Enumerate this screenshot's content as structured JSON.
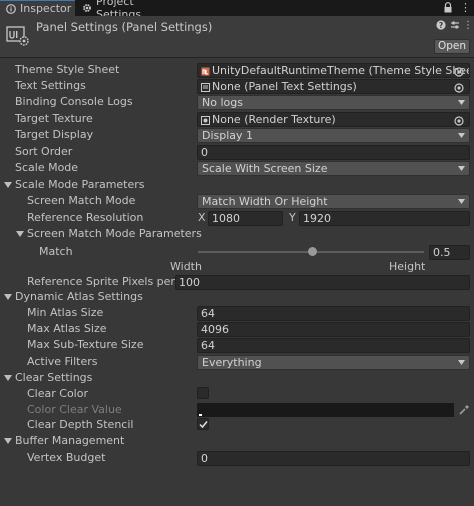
{
  "tabs": [
    {
      "label": "Inspector",
      "icon": "info-icon",
      "active": true
    },
    {
      "label": "Project Settings",
      "icon": "gear-icon",
      "active": false
    }
  ],
  "header": {
    "title": "Panel Settings (Panel Settings)",
    "open_label": "Open",
    "icons": [
      "help-icon",
      "presets-icon",
      "more-icon"
    ]
  },
  "props": {
    "theme_style_sheet": {
      "label": "Theme Style Sheet",
      "value": "UnityDefaultRuntimeTheme (Theme Style Sheet)"
    },
    "text_settings": {
      "label": "Text Settings",
      "value": "None (Panel Text Settings)"
    },
    "binding_console_logs": {
      "label": "Binding Console Logs",
      "value": "No logs"
    },
    "target_texture": {
      "label": "Target Texture",
      "value": "None (Render Texture)"
    },
    "target_display": {
      "label": "Target Display",
      "value": "Display 1"
    },
    "sort_order": {
      "label": "Sort Order",
      "value": "0"
    },
    "scale_mode": {
      "label": "Scale Mode",
      "value": "Scale With Screen Size"
    }
  },
  "scale_mode_params": {
    "header": "Scale Mode Parameters",
    "screen_match_mode": {
      "label": "Screen Match Mode",
      "value": "Match Width Or Height"
    },
    "reference_resolution": {
      "label": "Reference Resolution",
      "x_label": "X",
      "x": "1080",
      "y_label": "Y",
      "y": "1920"
    },
    "screen_match_mode_params": {
      "header": "Screen Match Mode Parameters",
      "match": {
        "label": "Match",
        "value": "0.5",
        "level": 0.5,
        "min_label": "Width",
        "max_label": "Height"
      }
    },
    "reference_sprite_ppu": {
      "label": "Reference Sprite Pixels per Unit",
      "value": "100"
    }
  },
  "dynamic_atlas": {
    "header": "Dynamic Atlas Settings",
    "min_atlas_size": {
      "label": "Min Atlas Size",
      "value": "64"
    },
    "max_atlas_size": {
      "label": "Max Atlas Size",
      "value": "4096"
    },
    "max_sub_texture_size": {
      "label": "Max Sub-Texture Size",
      "value": "64"
    },
    "active_filters": {
      "label": "Active Filters",
      "value": "Everything"
    }
  },
  "clear_settings": {
    "header": "Clear Settings",
    "clear_color": {
      "label": "Clear Color",
      "checked": false
    },
    "color_clear_value": {
      "label": "Color Clear Value",
      "color": "#191919"
    },
    "clear_depth_stencil": {
      "label": "Clear Depth Stencil",
      "checked": true
    }
  },
  "buffer_management": {
    "header": "Buffer Management",
    "vertex_budget": {
      "label": "Vertex Budget",
      "value": "0"
    }
  },
  "colors": {
    "background": "#383838",
    "field": "#2a2a2a",
    "dropdown": "#515151",
    "tab_accent": "#3a79bb"
  }
}
